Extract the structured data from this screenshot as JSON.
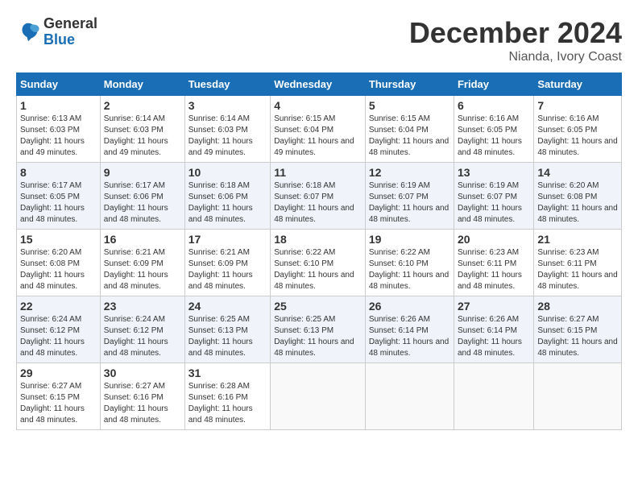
{
  "header": {
    "logo_text_general": "General",
    "logo_text_blue": "Blue",
    "month_title": "December 2024",
    "location": "Nianda, Ivory Coast"
  },
  "weekdays": [
    "Sunday",
    "Monday",
    "Tuesday",
    "Wednesday",
    "Thursday",
    "Friday",
    "Saturday"
  ],
  "weeks": [
    [
      {
        "day": "1",
        "sunrise": "6:13 AM",
        "sunset": "6:03 PM",
        "daylight": "11 hours and 49 minutes."
      },
      {
        "day": "2",
        "sunrise": "6:14 AM",
        "sunset": "6:03 PM",
        "daylight": "11 hours and 49 minutes."
      },
      {
        "day": "3",
        "sunrise": "6:14 AM",
        "sunset": "6:03 PM",
        "daylight": "11 hours and 49 minutes."
      },
      {
        "day": "4",
        "sunrise": "6:15 AM",
        "sunset": "6:04 PM",
        "daylight": "11 hours and 49 minutes."
      },
      {
        "day": "5",
        "sunrise": "6:15 AM",
        "sunset": "6:04 PM",
        "daylight": "11 hours and 48 minutes."
      },
      {
        "day": "6",
        "sunrise": "6:16 AM",
        "sunset": "6:05 PM",
        "daylight": "11 hours and 48 minutes."
      },
      {
        "day": "7",
        "sunrise": "6:16 AM",
        "sunset": "6:05 PM",
        "daylight": "11 hours and 48 minutes."
      }
    ],
    [
      {
        "day": "8",
        "sunrise": "6:17 AM",
        "sunset": "6:05 PM",
        "daylight": "11 hours and 48 minutes."
      },
      {
        "day": "9",
        "sunrise": "6:17 AM",
        "sunset": "6:06 PM",
        "daylight": "11 hours and 48 minutes."
      },
      {
        "day": "10",
        "sunrise": "6:18 AM",
        "sunset": "6:06 PM",
        "daylight": "11 hours and 48 minutes."
      },
      {
        "day": "11",
        "sunrise": "6:18 AM",
        "sunset": "6:07 PM",
        "daylight": "11 hours and 48 minutes."
      },
      {
        "day": "12",
        "sunrise": "6:19 AM",
        "sunset": "6:07 PM",
        "daylight": "11 hours and 48 minutes."
      },
      {
        "day": "13",
        "sunrise": "6:19 AM",
        "sunset": "6:07 PM",
        "daylight": "11 hours and 48 minutes."
      },
      {
        "day": "14",
        "sunrise": "6:20 AM",
        "sunset": "6:08 PM",
        "daylight": "11 hours and 48 minutes."
      }
    ],
    [
      {
        "day": "15",
        "sunrise": "6:20 AM",
        "sunset": "6:08 PM",
        "daylight": "11 hours and 48 minutes."
      },
      {
        "day": "16",
        "sunrise": "6:21 AM",
        "sunset": "6:09 PM",
        "daylight": "11 hours and 48 minutes."
      },
      {
        "day": "17",
        "sunrise": "6:21 AM",
        "sunset": "6:09 PM",
        "daylight": "11 hours and 48 minutes."
      },
      {
        "day": "18",
        "sunrise": "6:22 AM",
        "sunset": "6:10 PM",
        "daylight": "11 hours and 48 minutes."
      },
      {
        "day": "19",
        "sunrise": "6:22 AM",
        "sunset": "6:10 PM",
        "daylight": "11 hours and 48 minutes."
      },
      {
        "day": "20",
        "sunrise": "6:23 AM",
        "sunset": "6:11 PM",
        "daylight": "11 hours and 48 minutes."
      },
      {
        "day": "21",
        "sunrise": "6:23 AM",
        "sunset": "6:11 PM",
        "daylight": "11 hours and 48 minutes."
      }
    ],
    [
      {
        "day": "22",
        "sunrise": "6:24 AM",
        "sunset": "6:12 PM",
        "daylight": "11 hours and 48 minutes."
      },
      {
        "day": "23",
        "sunrise": "6:24 AM",
        "sunset": "6:12 PM",
        "daylight": "11 hours and 48 minutes."
      },
      {
        "day": "24",
        "sunrise": "6:25 AM",
        "sunset": "6:13 PM",
        "daylight": "11 hours and 48 minutes."
      },
      {
        "day": "25",
        "sunrise": "6:25 AM",
        "sunset": "6:13 PM",
        "daylight": "11 hours and 48 minutes."
      },
      {
        "day": "26",
        "sunrise": "6:26 AM",
        "sunset": "6:14 PM",
        "daylight": "11 hours and 48 minutes."
      },
      {
        "day": "27",
        "sunrise": "6:26 AM",
        "sunset": "6:14 PM",
        "daylight": "11 hours and 48 minutes."
      },
      {
        "day": "28",
        "sunrise": "6:27 AM",
        "sunset": "6:15 PM",
        "daylight": "11 hours and 48 minutes."
      }
    ],
    [
      {
        "day": "29",
        "sunrise": "6:27 AM",
        "sunset": "6:15 PM",
        "daylight": "11 hours and 48 minutes."
      },
      {
        "day": "30",
        "sunrise": "6:27 AM",
        "sunset": "6:16 PM",
        "daylight": "11 hours and 48 minutes."
      },
      {
        "day": "31",
        "sunrise": "6:28 AM",
        "sunset": "6:16 PM",
        "daylight": "11 hours and 48 minutes."
      },
      null,
      null,
      null,
      null
    ]
  ]
}
